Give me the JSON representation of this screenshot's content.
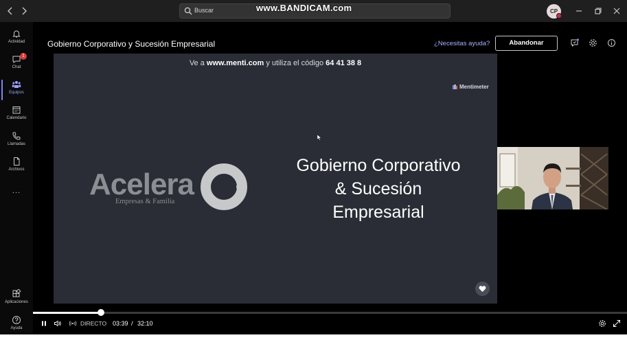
{
  "topbar": {
    "back_icon": "chevron-left-icon",
    "forward_icon": "chevron-right-icon",
    "search_placeholder": "Buscar",
    "watermark": "www.BANDICAM.com",
    "avatar_initials": "CP",
    "avatar_status_color": "#c4314b"
  },
  "sidebar": {
    "items": [
      {
        "label": "Actividad",
        "icon": "bell-icon"
      },
      {
        "label": "Chat",
        "icon": "chat-icon",
        "badge": "1"
      },
      {
        "label": "Equipos",
        "icon": "teams-icon",
        "active": true
      },
      {
        "label": "Calendario",
        "icon": "calendar-icon"
      },
      {
        "label": "Llamadas",
        "icon": "phone-icon"
      },
      {
        "label": "Archivos",
        "icon": "file-icon"
      },
      {
        "label": "...",
        "icon": "more-icon"
      }
    ],
    "bottom": [
      {
        "label": "Aplicaciones",
        "icon": "apps-icon"
      },
      {
        "label": "Ayuda",
        "icon": "help-icon"
      }
    ]
  },
  "meeting": {
    "title": "Gobierno Corporativo y Sucesión Empresarial",
    "help_link": "¿Necesitas ayuda?",
    "leave_label": "Abandonar"
  },
  "slide": {
    "instruction_prefix": "Ve a",
    "instruction_url": "www.menti.com",
    "instruction_middle": "y utiliza el código",
    "code": "64 41 38 8",
    "brand": "Mentimeter",
    "logo_text": "Acelera",
    "logo_subtitle": "Empresas & Familia",
    "title_line1": "Gobierno Corporativo",
    "title_line2": "& Sucesión",
    "title_line3": "Empresarial",
    "background_color": "#2a2d35"
  },
  "player": {
    "live_label": "DIRECTO",
    "current_time": "03:39",
    "separator": "/",
    "duration": "32:10",
    "progress_fraction": 0.114
  }
}
